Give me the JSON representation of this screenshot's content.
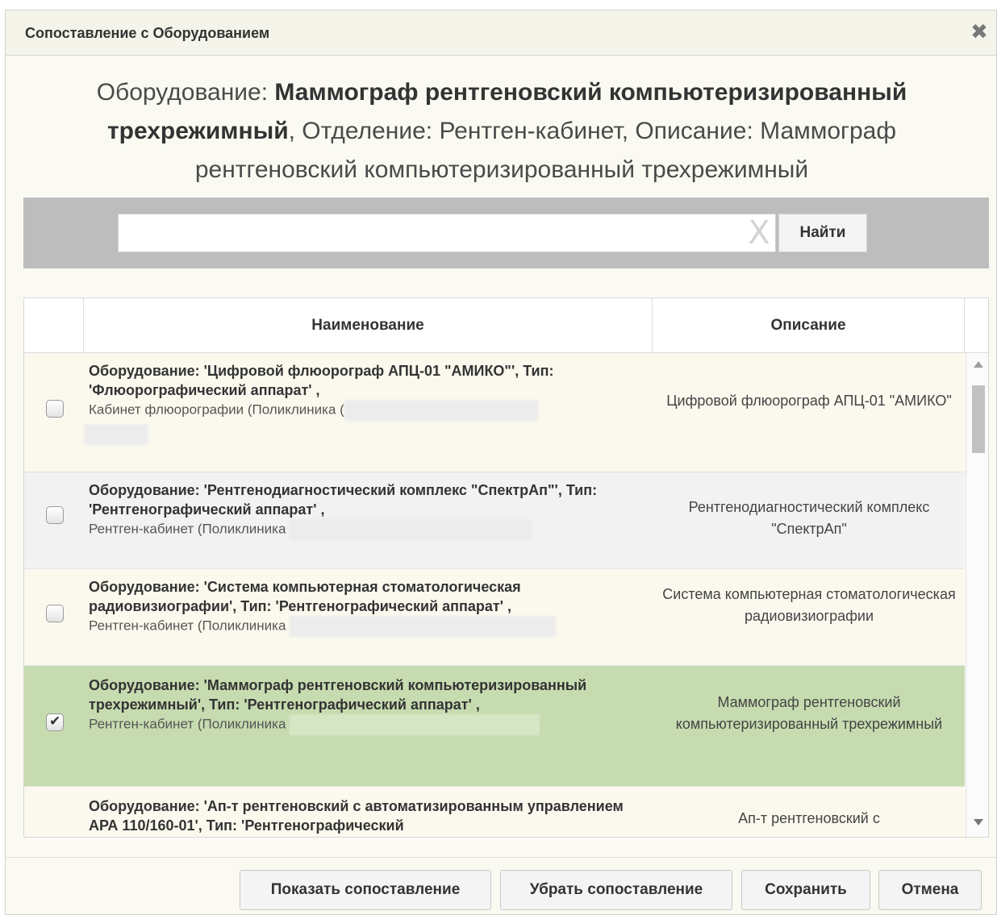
{
  "window": {
    "title": "Сопоставление с Оборудованием",
    "close_label": "✖"
  },
  "heading": {
    "label1": "Оборудование: ",
    "name": "Маммограф рентгеновский компьютеризированный трехрежимный",
    "rest": ", Отделение: Рентген-кабинет, Описание: Маммограф рентгеновский компьютеризированный трехрежимный"
  },
  "search": {
    "value": "",
    "placeholder": "",
    "clear_label": "X",
    "button_label": "Найти"
  },
  "table": {
    "columns": [
      "",
      "Наименование",
      "Описание"
    ],
    "rows": [
      {
        "checked": false,
        "name_bold": "Оборудование: 'Цифровой флюорограф АПЦ-01 \"АМИКО\"', Тип: 'Флюорографический аппарат' ,",
        "location": "Кабинет флюорографии (Поликлиника (",
        "description": "Цифровой флюорограф АПЦ-01 \"АМИКО\""
      },
      {
        "checked": false,
        "name_bold": "Оборудование: 'Рентгенодиагностический комплекс \"СпектрАп\"', Тип: 'Рентгенографический аппарат' ,",
        "location": "Рентген-кабинет (Поликлиника",
        "description": "Рентгенодиагностический комплекс \"СпектрАп\""
      },
      {
        "checked": false,
        "name_bold": "Оборудование: 'Система компьютерная стоматологическая радиовизиографии', Тип: 'Рентгенографический аппарат' ,",
        "location": "Рентген-кабинет (Поликлиника",
        "description": "Система компьютерная стоматологическая радиовизиографии"
      },
      {
        "checked": true,
        "name_bold": "Оборудование: 'Маммограф рентгеновский компьютеризированный трехрежимный', Тип: 'Рентгенографический аппарат' ,",
        "location": "Рентген-кабинет (Поликлиника",
        "description": "Маммограф рентгеновский компьютеризированный трехрежимный"
      },
      {
        "checked": false,
        "name_bold": "Оборудование: 'Ап-т рентгеновский с автоматизированным управлением АРА 110/160-01', Тип: 'Рентгенографический",
        "location": "",
        "description": "Ап-т рентгеновский с"
      }
    ]
  },
  "footer": {
    "show_mapping": "Показать сопоставление",
    "remove_mapping": "Убрать сопоставление",
    "save": "Сохранить",
    "cancel": "Отмена"
  },
  "colors": {
    "selected_row": "#c6dcb0",
    "search_band": "#bdbdbd",
    "dialog_bg": "#fbfaf2"
  }
}
